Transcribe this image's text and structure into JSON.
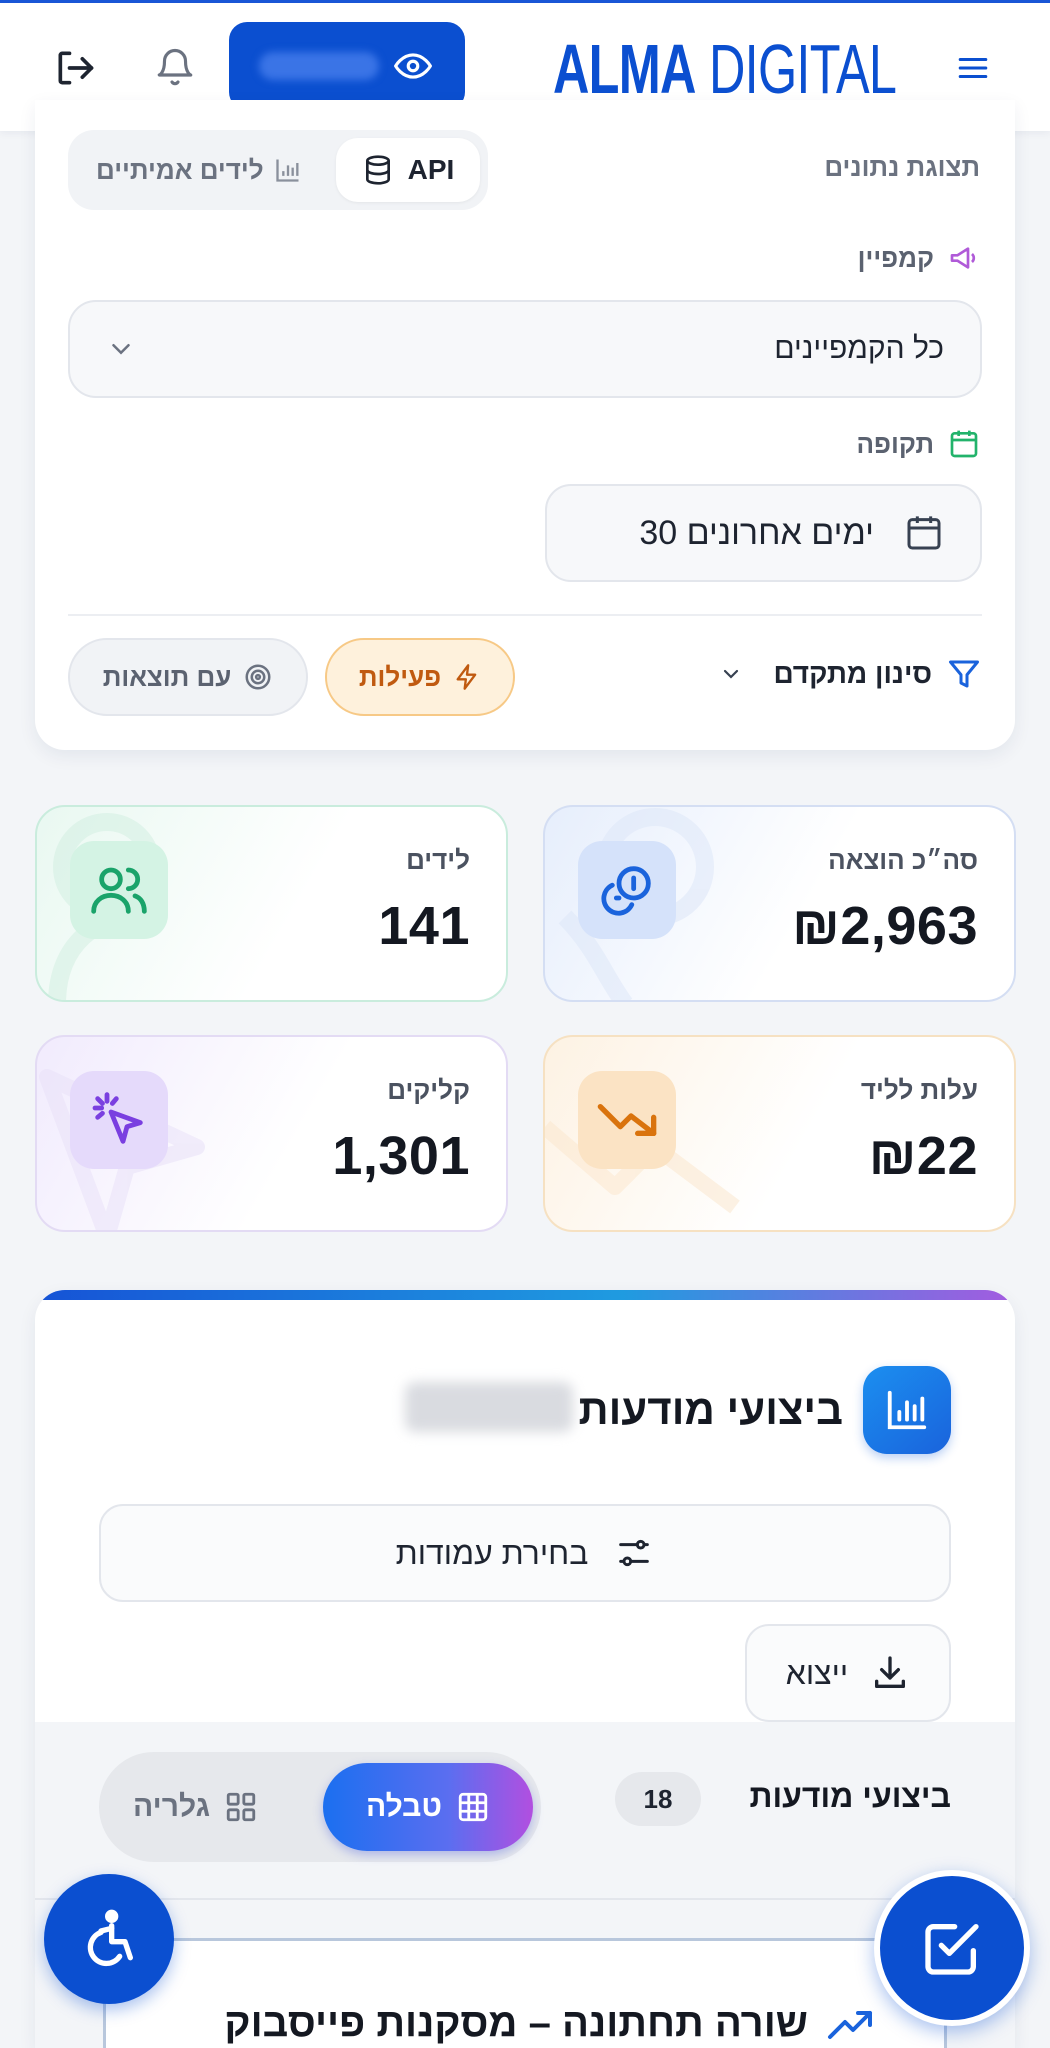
{
  "header": {
    "logo_bold": "ALMA",
    "logo_light": "DIGITAL",
    "accent_color": "#0b4fd0"
  },
  "filters": {
    "data_view_label": "תצוגת נתונים",
    "data_source_api": "API",
    "data_source_real_leads": "לידים אמיתיים",
    "campaign_label": "קמפיין",
    "campaign_value": "כל הקמפיינים",
    "period_label": "תקופה",
    "period_value": "30 ימים אחרונים",
    "advanced_filter_label": "סינון מתקדם",
    "chip_active": "פעילות",
    "chip_with_results": "עם תוצאות"
  },
  "stats": {
    "leads": {
      "label": "לידים",
      "value": "141",
      "color": "#1aa36a"
    },
    "total_spend": {
      "label": "סה״כ הוצאה",
      "value": "₪2,963",
      "color": "#1a63dc"
    },
    "clicks": {
      "label": "קליקים",
      "value": "1,301",
      "color": "#7a3fe0"
    },
    "cost_per_lead": {
      "label": "עלות לליד",
      "value": "₪22",
      "color": "#d9730d"
    }
  },
  "ads": {
    "title": "ביצועי מודעות",
    "choose_columns": "בחירת עמודות",
    "export": "ייצוא",
    "subtitle": "ביצועי מודעות",
    "count": "18",
    "view_table": "טבלה",
    "view_gallery": "גלריה",
    "preview_title": "שורה תחתונה – מסקנות פייסבוק"
  },
  "icons": {
    "logout": "logout-icon",
    "bell": "bell-icon",
    "eye": "eye-icon",
    "menu": "menu-icon",
    "accessibility": "accessibility-icon",
    "task": "task-check-icon"
  }
}
